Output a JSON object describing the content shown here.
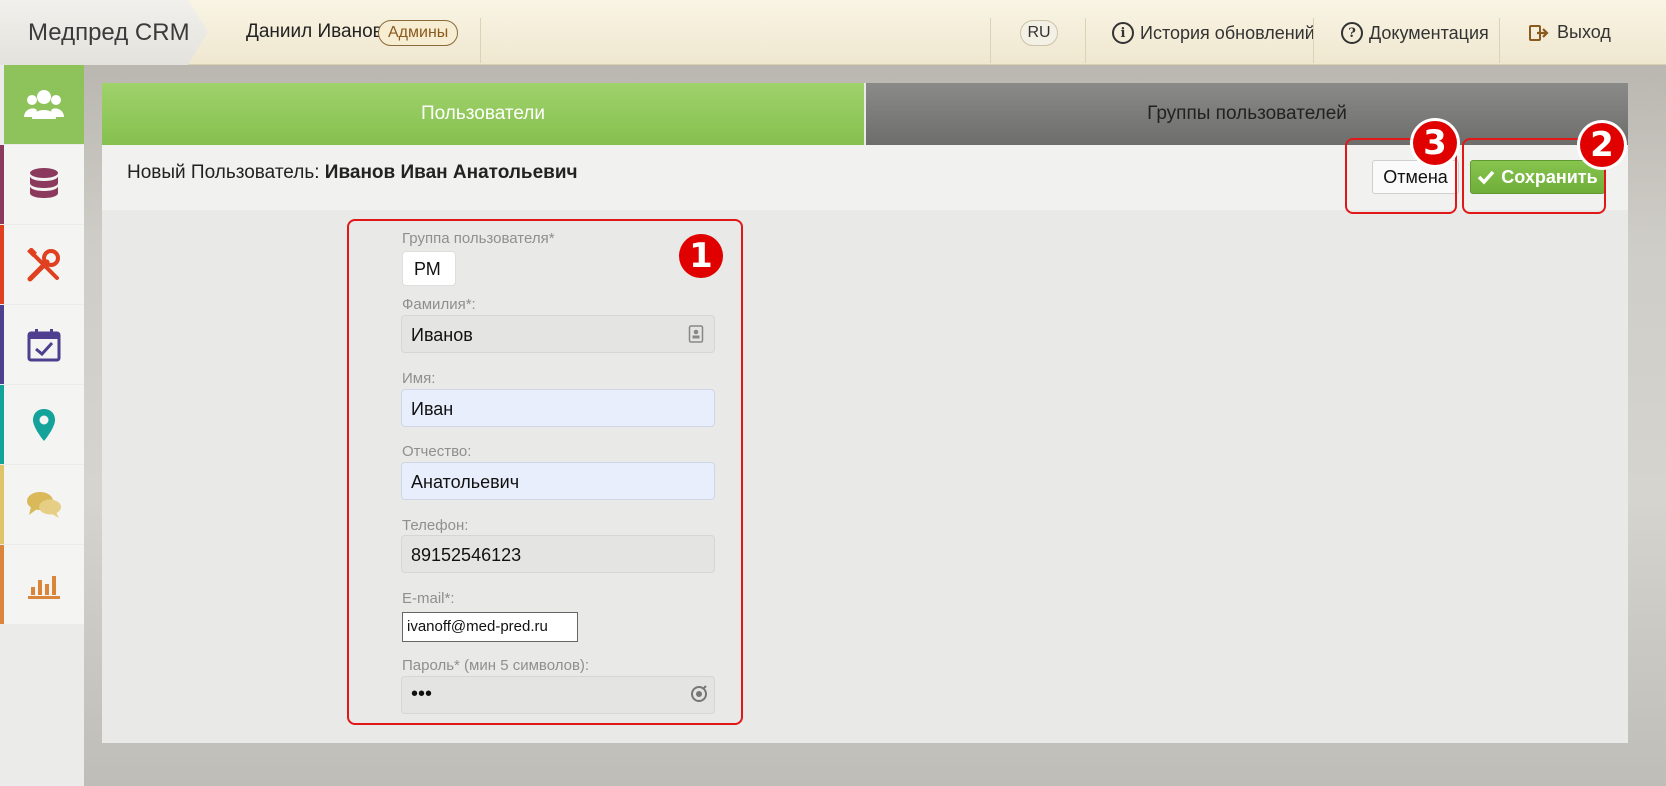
{
  "header": {
    "brand": "Медпред CRM",
    "user_name": "Даниил Иванов",
    "role_badge": "Админы",
    "lang": "RU",
    "links": {
      "history": "История обновлений",
      "docs": "Документация",
      "logout": "Выход"
    }
  },
  "sidebar": {
    "items": [
      {
        "icon": "users-icon",
        "color": "#8ec35b",
        "active": true
      },
      {
        "icon": "database-icon",
        "color": "#8b3a5d"
      },
      {
        "icon": "tools-icon",
        "color": "#e0401f"
      },
      {
        "icon": "calendar-check-icon",
        "color": "#4e3f8f"
      },
      {
        "icon": "map-marker-icon",
        "color": "#13a39a"
      },
      {
        "icon": "chat-icon",
        "color": "#e0c46a"
      },
      {
        "icon": "bar-chart-icon",
        "color": "#d9863a"
      }
    ]
  },
  "tabs": {
    "users": "Пользователи",
    "groups": "Группы пользователей"
  },
  "form": {
    "title_prefix": "Новый Пользователь:",
    "title_name": "Иванов Иван Анатольевич",
    "cancel_label": "Отмена",
    "save_label": "Сохранить",
    "fields": {
      "group": {
        "label": "Группа пользователя*",
        "value": "РМ"
      },
      "last_name": {
        "label": "Фамилия*:",
        "value": "Иванов"
      },
      "first_name": {
        "label": "Имя:",
        "value": "Иван"
      },
      "patronymic": {
        "label": "Отчество:",
        "value": "Анатольевич"
      },
      "phone": {
        "label": "Телефон:",
        "value": "89152546123"
      },
      "email": {
        "label": "E-mail*:",
        "value": "ivanoff@med-pred.ru"
      },
      "password": {
        "label": "Пароль* (мин 5 символов):",
        "value": "•••"
      }
    }
  },
  "annotations": {
    "one": "1",
    "two": "2",
    "three": "3"
  },
  "colors": {
    "accent_green": "#86c04f",
    "annotation_red": "#e01818"
  }
}
